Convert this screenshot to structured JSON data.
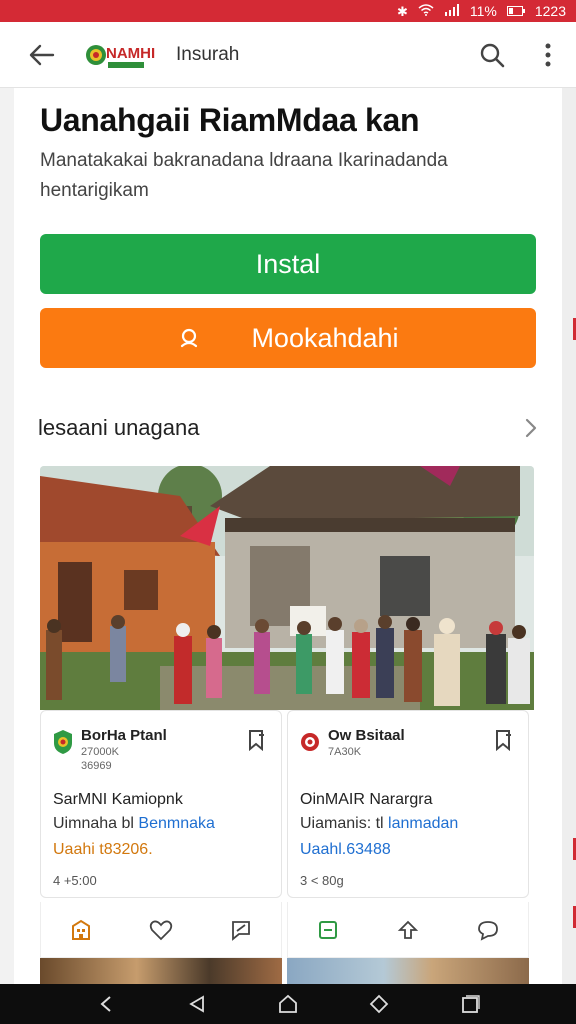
{
  "status_bar": {
    "battery": "11%",
    "time": "1223"
  },
  "app_bar": {
    "logo_text": "NAMHI",
    "title": "Insurah"
  },
  "page": {
    "title": "Uanahgaii RiamMdaa kan",
    "description": "Manatakakai bakranadana ldraana Ikarinadanda hentarigikam"
  },
  "buttons": {
    "install_label": "Instal",
    "secondary_label": "Mookahdahi"
  },
  "section": {
    "title": "lesaani unagana"
  },
  "cards": [
    {
      "name": "BorHa Ptanl",
      "meta1": "27000K",
      "meta2": "36969",
      "heading": "SarMNI Kamiopnk",
      "line_prefix": "Uimnaha bl",
      "line_link": "Benmnaka",
      "price": "Uaahi t83206.",
      "footer": "4 +5:00"
    },
    {
      "name": "Ow Bsitaal",
      "meta1": "7A30K",
      "meta2": "",
      "heading": "OinMAIR Narargra",
      "line_prefix": "Uiamanis: tl",
      "line_link": "lanmadan",
      "price": "Uaahl.63488",
      "footer": "3 < 80g"
    }
  ],
  "colors": {
    "status_bar": "#d42a35",
    "install": "#1fa84a",
    "secondary": "#fb7a11",
    "link": "#1f6fd1",
    "price_orange": "#d2780e"
  },
  "icons": {
    "back": "arrow-left-icon",
    "search": "search-icon",
    "menu": "more-vert-icon",
    "chevron": "chevron-right-icon"
  }
}
